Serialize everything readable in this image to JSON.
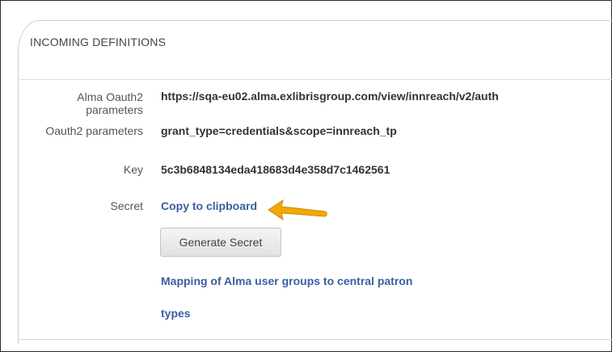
{
  "panel": {
    "title": "INCOMING DEFINITIONS"
  },
  "fields": {
    "alma_oauth2_label_line1": "Alma Oauth2",
    "alma_oauth2_label_line2": "parameters",
    "alma_oauth2_value": "https://sqa-eu02.alma.exlibrisgroup.com/view/innreach/v2/auth",
    "oauth2_label": "Oauth2 parameters",
    "oauth2_value": "grant_type=credentials&scope=innreach_tp",
    "key_label": "Key",
    "key_value": "5c3b6848134eda418683d4e358d7c1462561",
    "secret_label": "Secret",
    "secret_link": "Copy to clipboard"
  },
  "buttons": {
    "generate_secret": "Generate Secret"
  },
  "links": {
    "mapping_line1": "Mapping of Alma user groups to central patron",
    "mapping_line2": "types"
  },
  "colors": {
    "link": "#3a5f9e",
    "arrow": "#f2a900"
  },
  "icons": {
    "arrow": "arrow-left-icon"
  }
}
